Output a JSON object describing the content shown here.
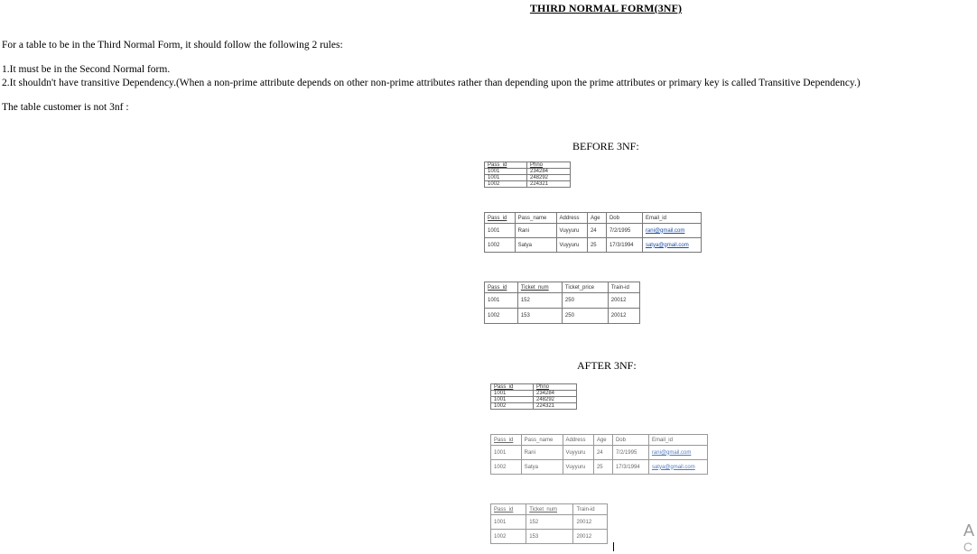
{
  "document": {
    "title": "THIRD NORMAL FORM(3NF)",
    "intro": "For a table to be in the Third Normal Form, it should follow the following 2 rules:",
    "rule1": "1.It must be in the Second Normal form.",
    "rule2": "2.It shouldn't have transitive Dependency.(When a non-prime attribute depends on other non-prime attributes rather than depending upon the prime attributes or primary key is called Transitive Dependency.)",
    "note": "The table customer is not 3nf :",
    "before_heading": "BEFORE 3NF:",
    "after_heading": "AFTER 3NF:",
    "edge_char_1": "A",
    "edge_char_2": "C"
  },
  "before": {
    "phone_table": {
      "headers": [
        "Pass_id",
        "Phno"
      ],
      "rows": [
        [
          "1001",
          "234284"
        ],
        [
          "1001",
          "248292"
        ],
        [
          "1002",
          "224321"
        ]
      ]
    },
    "passenger_table": {
      "headers": [
        "Pass_id",
        "Pass_name",
        "Address",
        "Age",
        "Dob",
        "Email_id"
      ],
      "rows": [
        [
          "1001",
          "Rani",
          "Vuyyuru",
          "24",
          "7/2/1995",
          "rani@gmail.com"
        ],
        [
          "1002",
          "Satya",
          "Vuyyuru",
          "25",
          "17/3/1994",
          "satya@gmail.com"
        ]
      ]
    },
    "ticket_table": {
      "headers": [
        "Pass_id",
        "Ticket_num",
        "Ticket_price",
        "Train-id"
      ],
      "rows": [
        [
          "1001",
          "152",
          "250",
          "20012"
        ],
        [
          "1002",
          "153",
          "250",
          "20012"
        ]
      ]
    }
  },
  "after": {
    "phone_table": {
      "headers": [
        "Pass_id",
        "Phno"
      ],
      "rows": [
        [
          "1001",
          "234284"
        ],
        [
          "1001",
          "248292"
        ],
        [
          "1002",
          "224321"
        ]
      ]
    },
    "passenger_table": {
      "headers": [
        "Pass_id",
        "Pass_name",
        "Address",
        "Age",
        "Dob",
        "Email_id"
      ],
      "rows": [
        [
          "1001",
          "Rani",
          "Vuyyuru",
          "24",
          "7/2/1995",
          "rani@gmail.com"
        ],
        [
          "1002",
          "Satya",
          "Vuyyuru",
          "25",
          "17/3/1994",
          "satya@gmail.com"
        ]
      ]
    },
    "ticket_table": {
      "headers": [
        "Pass_id",
        "Ticket_num",
        "Train-id"
      ],
      "rows": [
        [
          "1001",
          "152",
          "20012"
        ],
        [
          "1002",
          "153",
          "20012"
        ]
      ]
    }
  }
}
